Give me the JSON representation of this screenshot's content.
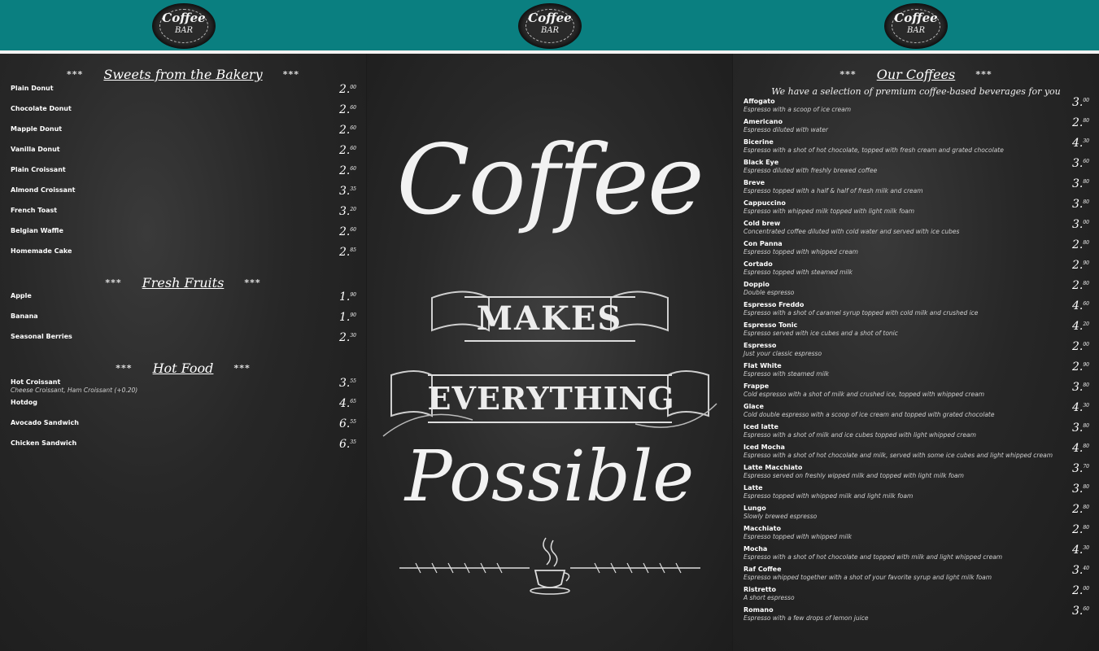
{
  "logos": [
    {
      "line1": "Coffee",
      "line2": "BAR"
    },
    {
      "line1": "Coffee",
      "line2": "BAR"
    },
    {
      "line1": "Coffee",
      "line2": "BAR"
    }
  ],
  "left": {
    "bakery": {
      "stars": "***",
      "title": "Sweets from the Bakery",
      "items": [
        {
          "name": "Plain Donut",
          "price_main": "2.",
          "price_cents": "00"
        },
        {
          "name": "Chocolate Donut",
          "price_main": "2.",
          "price_cents": "60"
        },
        {
          "name": "Mapple Donut",
          "price_main": "2.",
          "price_cents": "60"
        },
        {
          "name": "Vanilla Donut",
          "price_main": "2.",
          "price_cents": "60"
        },
        {
          "name": "Plain Croissant",
          "price_main": "2.",
          "price_cents": "60"
        },
        {
          "name": "Almond Croissant",
          "price_main": "3.",
          "price_cents": "35"
        },
        {
          "name": "French Toast",
          "price_main": "3.",
          "price_cents": "20"
        },
        {
          "name": "Belgian Waffle",
          "price_main": "2.",
          "price_cents": "60"
        },
        {
          "name": "Homemade Cake",
          "price_main": "2.",
          "price_cents": "85"
        }
      ]
    },
    "fruits": {
      "stars": "***",
      "title": "Fresh Fruits",
      "items": [
        {
          "name": "Apple",
          "price_main": "1.",
          "price_cents": "90"
        },
        {
          "name": "Banana",
          "price_main": "1.",
          "price_cents": "90"
        },
        {
          "name": "Seasonal Berries",
          "price_main": "2.",
          "price_cents": "30"
        }
      ]
    },
    "hot": {
      "stars": "***",
      "title": "Hot Food",
      "items": [
        {
          "name": "Hot Croissant",
          "desc": "Cheese Croissant, Ham Croissant (+0.20)",
          "price_main": "3.",
          "price_cents": "55"
        },
        {
          "name": "Hotdog",
          "price_main": "4.",
          "price_cents": "65"
        },
        {
          "name": "Avocado Sandwich",
          "price_main": "6.",
          "price_cents": "55"
        },
        {
          "name": "Chicken Sandwich",
          "price_main": "6.",
          "price_cents": "35"
        }
      ]
    }
  },
  "poster": {
    "word1": "Coffee",
    "word2": "MAKES",
    "word3": "EVERYTHING",
    "word4": "Possible"
  },
  "right": {
    "stars": "***",
    "title": "Our Coffees",
    "subtitle": "We have a selection of premium coffee-based beverages for you",
    "items": [
      {
        "name": "Affogato",
        "desc": "Espresso with a scoop of ice cream",
        "price_main": "3.",
        "price_cents": "00"
      },
      {
        "name": "Americano",
        "desc": "Espresso diluted with water",
        "price_main": "2.",
        "price_cents": "80"
      },
      {
        "name": "Bicerine",
        "desc": "Espresso with a shot of hot chocolate, topped with fresh cream and grated chocolate",
        "price_main": "4.",
        "price_cents": "30"
      },
      {
        "name": "Black Eye",
        "desc": "Espresso diluted with freshly brewed coffee",
        "price_main": "3.",
        "price_cents": "60"
      },
      {
        "name": "Breve",
        "desc": "Espresso topped with a half & half of fresh milk and cream",
        "price_main": "3.",
        "price_cents": "80"
      },
      {
        "name": "Cappuccino",
        "desc": "Espresso with whipped milk topped with light milk foam",
        "price_main": "3.",
        "price_cents": "80"
      },
      {
        "name": "Cold brew",
        "desc": "Concentrated coffee diluted with cold water and served with ice cubes",
        "price_main": "3.",
        "price_cents": "00"
      },
      {
        "name": "Con Panna",
        "desc": "Espresso topped with whipped cream",
        "price_main": "2.",
        "price_cents": "80"
      },
      {
        "name": "Cortado",
        "desc": "Espresso topped with steamed milk",
        "price_main": "2.",
        "price_cents": "90"
      },
      {
        "name": "Doppio",
        "desc": "Double espresso",
        "price_main": "2.",
        "price_cents": "80"
      },
      {
        "name": "Espresso Freddo",
        "desc": "Espresso with a shot of caramel syrup topped with cold milk and crushed ice",
        "price_main": "4.",
        "price_cents": "60"
      },
      {
        "name": "Espresso Tonic",
        "desc": "Espresso served with ice cubes and a shot of tonic",
        "price_main": "4.",
        "price_cents": "20"
      },
      {
        "name": "Espresso",
        "desc": "Just your classic espresso",
        "price_main": "2.",
        "price_cents": "00"
      },
      {
        "name": "Flat White",
        "desc": "Espresso with steamed milk",
        "price_main": "2.",
        "price_cents": "90"
      },
      {
        "name": "Frappe",
        "desc": "Cold espresso with a shot of milk and crushed ice, topped with whipped cream",
        "price_main": "3.",
        "price_cents": "80"
      },
      {
        "name": "Glace",
        "desc": "Cold double espresso with a scoop of ice cream and topped with grated chocolate",
        "price_main": "4.",
        "price_cents": "30"
      },
      {
        "name": "Iced latte",
        "desc": "Espresso with a shot of milk and ice cubes topped with light whipped cream",
        "price_main": "3.",
        "price_cents": "80"
      },
      {
        "name": "Iced Mocha",
        "desc": "Espresso with a shot of hot chocolate and milk, served with some ice cubes and light whipped cream",
        "price_main": "4.",
        "price_cents": "80"
      },
      {
        "name": "Latte Macchiato",
        "desc": "Espresso served on freshly wipped milk and topped with light milk foam",
        "price_main": "3.",
        "price_cents": "70"
      },
      {
        "name": "Latte",
        "desc": "Espresso topped with whipped milk and light milk foam",
        "price_main": "3.",
        "price_cents": "80"
      },
      {
        "name": "Lungo",
        "desc": "Slowly brewed espresso",
        "price_main": "2.",
        "price_cents": "80"
      },
      {
        "name": "Macchiato",
        "desc": "Espresso topped with whipped milk",
        "price_main": "2.",
        "price_cents": "80"
      },
      {
        "name": "Mocha",
        "desc": "Espresso with a shot of hot chocolate and topped with milk and light whipped cream",
        "price_main": "4.",
        "price_cents": "30"
      },
      {
        "name": "Raf Coffee",
        "desc": "Espresso whipped together with a shot of your favorite syrup and light milk foam",
        "price_main": "3.",
        "price_cents": "40"
      },
      {
        "name": "Ristretto",
        "desc": "A short espresso",
        "price_main": "2.",
        "price_cents": "00"
      },
      {
        "name": "Romano",
        "desc": "Espresso with a few drops of lemon juice",
        "price_main": "3.",
        "price_cents": "60"
      }
    ]
  }
}
